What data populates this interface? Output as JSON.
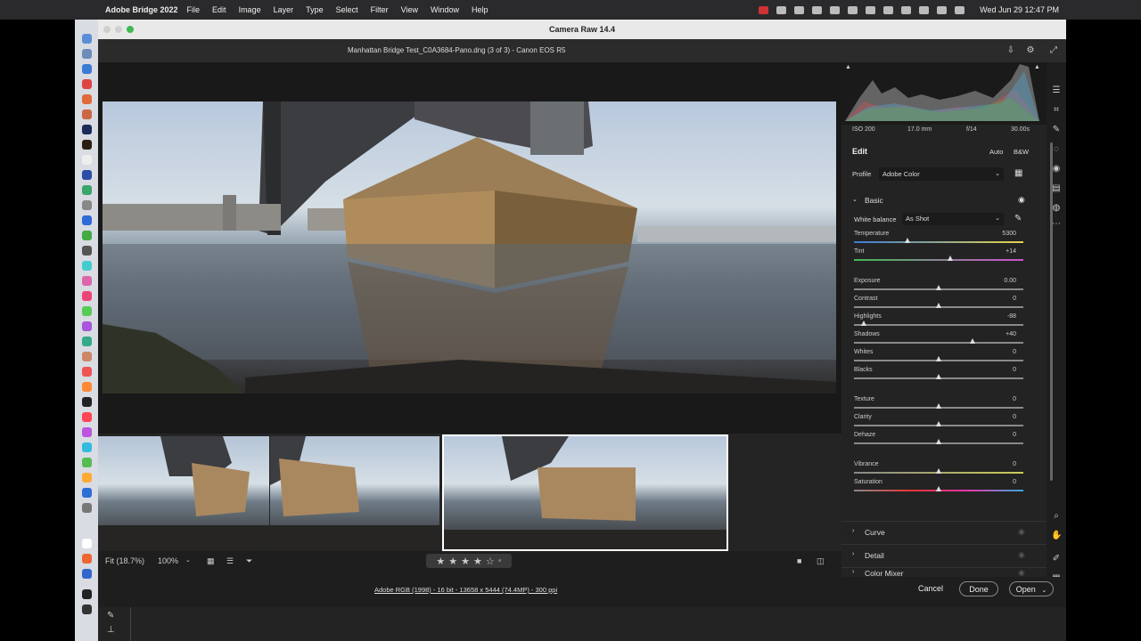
{
  "menubar": {
    "app": "Adobe Bridge 2022",
    "items": [
      "File",
      "Edit",
      "Image",
      "Layer",
      "Type",
      "Select",
      "Filter",
      "View",
      "Window",
      "Help"
    ],
    "clock": "Wed Jun 29  12:47 PM"
  },
  "window": {
    "title": "Camera Raw 14.4",
    "filename": "Manhattan Bridge Test_C0A3684-Pano.dng (3 of 3)  -  Canon EOS R5"
  },
  "exif": {
    "iso": "ISO 200",
    "focal": "17.0 mm",
    "aperture": "f/14",
    "shutter": "30.00s"
  },
  "edit": {
    "title": "Edit",
    "auto": "Auto",
    "bw": "B&W",
    "profile_label": "Profile",
    "profile_value": "Adobe Color"
  },
  "basic": {
    "title": "Basic",
    "wb_label": "White balance",
    "wb_value": "As Shot",
    "sliders": [
      {
        "label": "Temperature",
        "value": "5300",
        "pos": 0.32
      },
      {
        "label": "Tint",
        "value": "+14",
        "pos": 0.57
      },
      {
        "label": "Exposure",
        "value": "0.00",
        "pos": 0.5
      },
      {
        "label": "Contrast",
        "value": "0",
        "pos": 0.5
      },
      {
        "label": "Highlights",
        "value": "-88",
        "pos": 0.06
      },
      {
        "label": "Shadows",
        "value": "+40",
        "pos": 0.7
      },
      {
        "label": "Whites",
        "value": "0",
        "pos": 0.5
      },
      {
        "label": "Blacks",
        "value": "0",
        "pos": 0.5
      },
      {
        "label": "Texture",
        "value": "0",
        "pos": 0.5
      },
      {
        "label": "Clarity",
        "value": "0",
        "pos": 0.5
      },
      {
        "label": "Dehaze",
        "value": "0",
        "pos": 0.5
      },
      {
        "label": "Vibrance",
        "value": "0",
        "pos": 0.5
      },
      {
        "label": "Saturation",
        "value": "0",
        "pos": 0.5
      }
    ]
  },
  "sections": [
    "Curve",
    "Detail",
    "Color Mixer"
  ],
  "toolbar": {
    "fit": "Fit (18.7%)",
    "zoom": "100%"
  },
  "footer": {
    "info": "Adobe RGB (1998) - 16 bit - 13658 x 5444 (74.4MP) - 300 ppi",
    "cancel": "Cancel",
    "done": "Done",
    "open": "Open"
  },
  "rating": {
    "stars": 4,
    "max": 5
  }
}
